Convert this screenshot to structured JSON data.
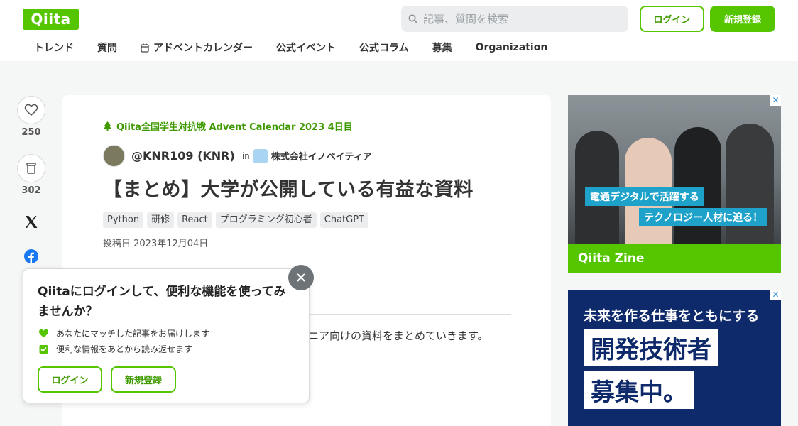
{
  "header": {
    "logo": "Qiita",
    "search_placeholder": "記事、質問を検索",
    "login_label": "ログイン",
    "signup_label": "新規登録",
    "nav": [
      "トレンド",
      "質問",
      "アドベントカレンダー",
      "公式イベント",
      "公式コラム",
      "募集",
      "Organization"
    ]
  },
  "rail": {
    "like_count": "250",
    "stock_count": "302"
  },
  "article": {
    "calendar": "Qiita全国学生対抗戦 Advent Calendar 2023 4日目",
    "author": "@KNR109 (KNR)",
    "in_label": "in",
    "organization": "株式会社イノベイティア",
    "title": "【まとめ】大学が公開している有益な資料",
    "tags": [
      "Python",
      "研修",
      "React",
      "プログラミング初心者",
      "ChatGPT"
    ],
    "posted": "投稿日 2023年12月04日",
    "body_fragment": "ニア向けの資料をまとめていきます。"
  },
  "popup": {
    "title": "Qiitaにログインして、便利な機能を使ってみませんか？",
    "benefit1": "あなたにマッチした記事をお届けします",
    "benefit2": "便利な情報をあとから読み返せます",
    "login_label": "ログイン",
    "signup_label": "新規登録"
  },
  "ads": {
    "ad1_tag1": "電通デジタルで活躍する",
    "ad1_tag2": "テクノロジー人材に迫る！",
    "ad1_brand": "Qiita Zine",
    "ad2_line1": "未来を作る仕事をともにする",
    "ad2_box1": "開発技術者",
    "ad2_box2": "募集中。"
  },
  "colors": {
    "brand_green": "#55c500",
    "link_green": "#3f9a00"
  }
}
